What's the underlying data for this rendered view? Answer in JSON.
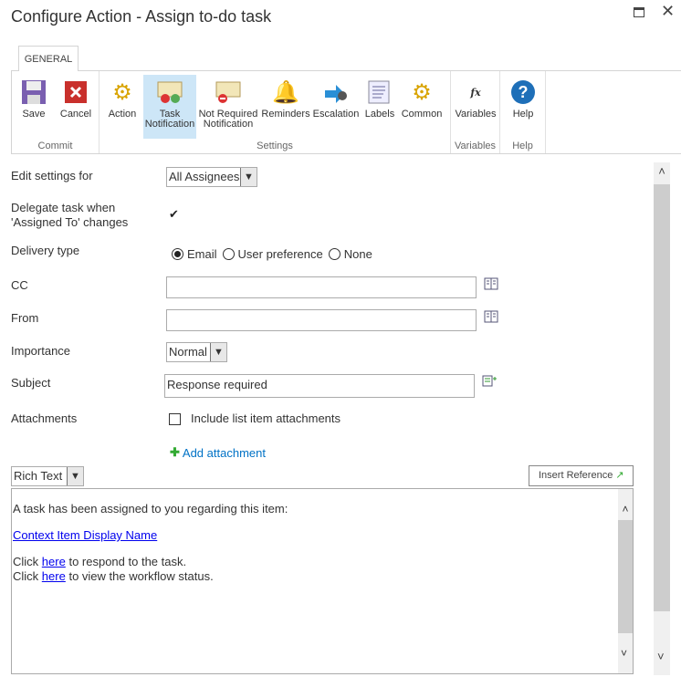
{
  "window": {
    "title": "Configure Action - Assign to-do task"
  },
  "ribbon": {
    "tab": "GENERAL",
    "groups": [
      {
        "label": "Commit"
      },
      {
        "label": "Settings"
      },
      {
        "label": "Variables"
      },
      {
        "label": "Help"
      }
    ],
    "buttons": {
      "save": "Save",
      "cancel": "Cancel",
      "action": "Action",
      "task_notification_1": "Task",
      "task_notification_2": "Notification",
      "not_required_1": "Not Required",
      "not_required_2": "Notification",
      "reminders": "Reminders",
      "escalation": "Escalation",
      "labels": "Labels",
      "common": "Common",
      "variables": "Variables",
      "help": "Help"
    }
  },
  "form": {
    "edit_settings_label": "Edit settings for",
    "edit_settings_value": "All Assignees",
    "delegate_label_1": "Delegate task when",
    "delegate_label_2": "'Assigned To' changes",
    "delegate_checked": true,
    "delivery_label": "Delivery type",
    "delivery_options": [
      "Email",
      "User preference",
      "None"
    ],
    "delivery_selected": "Email",
    "cc_label": "CC",
    "cc_value": "",
    "from_label": "From",
    "from_value": "",
    "importance_label": "Importance",
    "importance_value": "Normal",
    "subject_label": "Subject",
    "subject_value": "Response required",
    "attachments_label": "Attachments",
    "include_attachments": "Include list item attachments",
    "add_attachment": "Add attachment",
    "format_value": "Rich Text",
    "insert_reference": "Insert Reference"
  },
  "body": {
    "line1": "A task has been assigned to you regarding this item:",
    "context_link": "Context Item Display Name",
    "click": "Click",
    "here": "here",
    "respond_suffix": "to respond to the task.",
    "status_suffix": "to view the workflow status."
  }
}
